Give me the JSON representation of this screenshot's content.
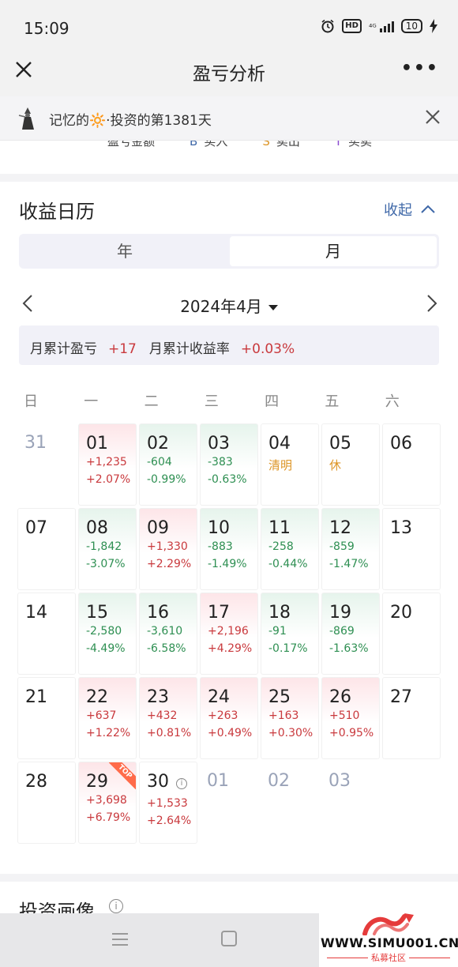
{
  "status": {
    "time": "15:09",
    "hd": "HD",
    "signal": "⁴ᴳ",
    "battery": "10"
  },
  "title_bar": {
    "title": "盈亏分析",
    "more": "•••"
  },
  "banner": {
    "text": "记忆的🔆·投资的第1381天"
  },
  "legend": {
    "items": [
      {
        "mark": "",
        "text": "盈亏金额"
      },
      {
        "mark": "B",
        "text": "买入"
      },
      {
        "mark": "S",
        "text": "卖出"
      },
      {
        "mark": "T",
        "text": "买卖"
      }
    ]
  },
  "calendar": {
    "heading": "收益日历",
    "collapse_label": "收起",
    "segments": [
      "年",
      "月"
    ],
    "active_segment": "月",
    "month_label": "2024年4月",
    "summary": {
      "pnl_label": "月累计盈亏",
      "pnl_value": "+17",
      "rate_label": "月累计收益率",
      "rate_value": "+0.03%"
    },
    "weekdays": [
      "日",
      "一",
      "二",
      "三",
      "四",
      "五",
      "六"
    ],
    "weeks": [
      [
        {
          "day": "31",
          "state": "other"
        },
        {
          "day": "01",
          "state": "up",
          "amount": "+1,235",
          "pct": "+2.07%"
        },
        {
          "day": "02",
          "state": "down",
          "amount": "-604",
          "pct": "-0.99%"
        },
        {
          "day": "03",
          "state": "down",
          "amount": "-383",
          "pct": "-0.63%"
        },
        {
          "day": "04",
          "state": "holiday",
          "note": "清明"
        },
        {
          "day": "05",
          "state": "holiday",
          "note": "休"
        },
        {
          "day": "06",
          "state": "plain"
        }
      ],
      [
        {
          "day": "07",
          "state": "plain"
        },
        {
          "day": "08",
          "state": "down",
          "amount": "-1,842",
          "pct": "-3.07%"
        },
        {
          "day": "09",
          "state": "up",
          "amount": "+1,330",
          "pct": "+2.29%"
        },
        {
          "day": "10",
          "state": "down",
          "amount": "-883",
          "pct": "-1.49%"
        },
        {
          "day": "11",
          "state": "down",
          "amount": "-258",
          "pct": "-0.44%"
        },
        {
          "day": "12",
          "state": "down",
          "amount": "-859",
          "pct": "-1.47%"
        },
        {
          "day": "13",
          "state": "plain"
        }
      ],
      [
        {
          "day": "14",
          "state": "plain"
        },
        {
          "day": "15",
          "state": "down",
          "amount": "-2,580",
          "pct": "-4.49%"
        },
        {
          "day": "16",
          "state": "down",
          "amount": "-3,610",
          "pct": "-6.58%"
        },
        {
          "day": "17",
          "state": "up",
          "amount": "+2,196",
          "pct": "+4.29%"
        },
        {
          "day": "18",
          "state": "down",
          "amount": "-91",
          "pct": "-0.17%"
        },
        {
          "day": "19",
          "state": "down",
          "amount": "-869",
          "pct": "-1.63%"
        },
        {
          "day": "20",
          "state": "plain"
        }
      ],
      [
        {
          "day": "21",
          "state": "plain"
        },
        {
          "day": "22",
          "state": "up",
          "amount": "+637",
          "pct": "+1.22%"
        },
        {
          "day": "23",
          "state": "up",
          "amount": "+432",
          "pct": "+0.81%"
        },
        {
          "day": "24",
          "state": "up",
          "amount": "+263",
          "pct": "+0.49%"
        },
        {
          "day": "25",
          "state": "up",
          "amount": "+163",
          "pct": "+0.30%"
        },
        {
          "day": "26",
          "state": "up",
          "amount": "+510",
          "pct": "+0.95%"
        },
        {
          "day": "27",
          "state": "plain"
        }
      ],
      [
        {
          "day": "28",
          "state": "plain"
        },
        {
          "day": "29",
          "state": "up",
          "amount": "+3,698",
          "pct": "+6.79%",
          "badge": "TOP"
        },
        {
          "day": "30",
          "state": "plain",
          "amount": "+1,533",
          "pct": "+2.64%",
          "info": "i"
        },
        {
          "day": "01",
          "state": "other"
        },
        {
          "day": "02",
          "state": "other"
        },
        {
          "day": "03",
          "state": "other"
        }
      ]
    ]
  },
  "next_section": {
    "heading": "投资画像",
    "help": "i"
  },
  "watermark": {
    "site": "WWW.SIMU001.CN",
    "sub": "私募社区"
  },
  "colors": {
    "gain": "#c9393d",
    "loss": "#2e8f52",
    "holiday": "#dd9628",
    "link": "#3f68a8"
  }
}
